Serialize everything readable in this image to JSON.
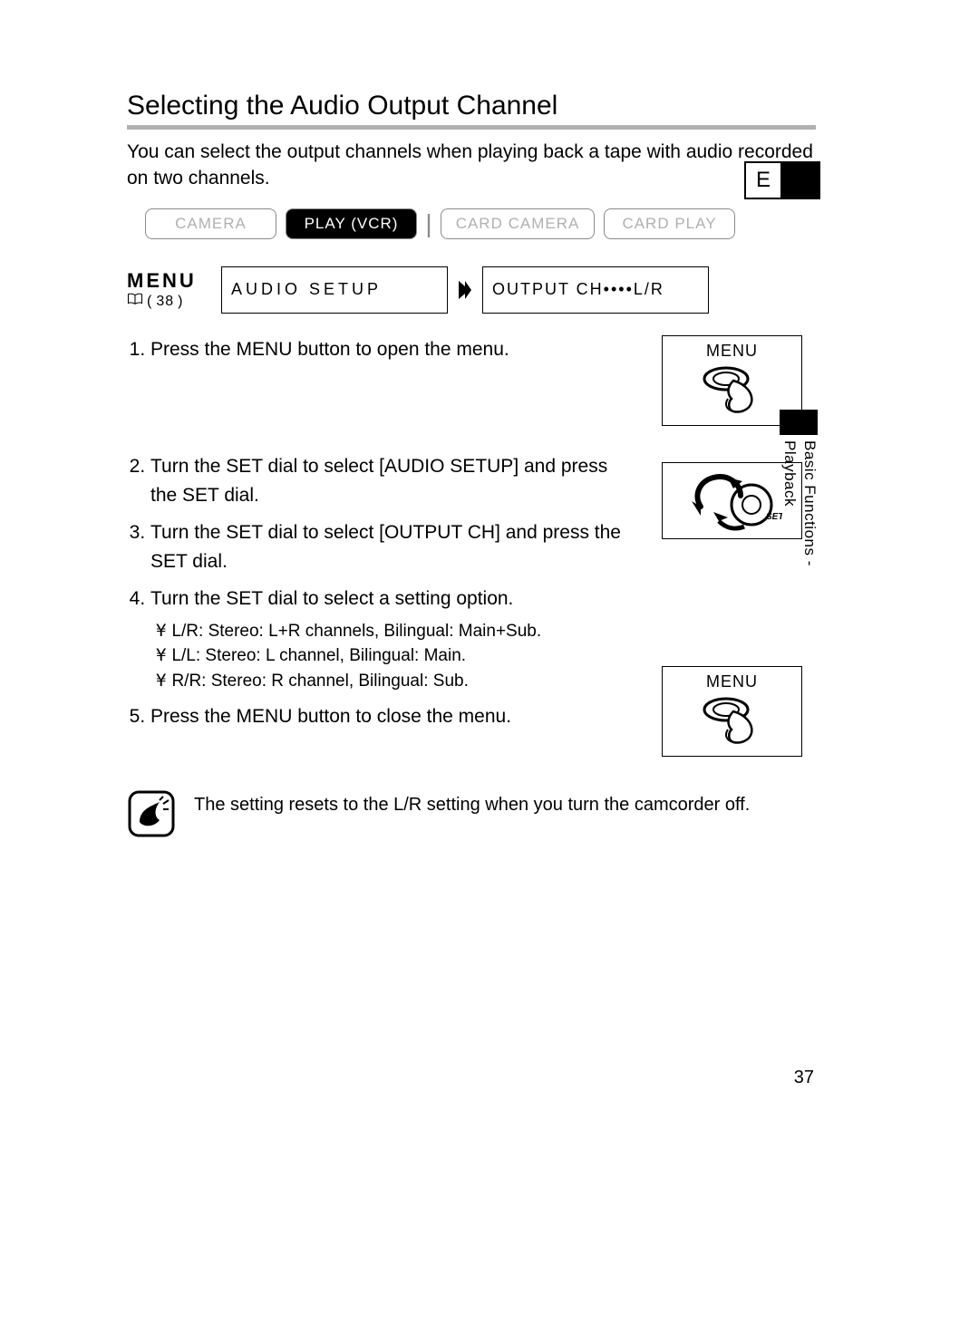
{
  "title": "Selecting the Audio Output Channel",
  "intro": "You can select the output channels when playing back a tape with audio recorded on two channels.",
  "modes": {
    "camera": "CAMERA",
    "play_vcr": "PLAY (VCR)",
    "card_camera": "CARD CAMERA",
    "card_play": "CARD PLAY"
  },
  "menu": {
    "label": "MENU",
    "ref_page": "38",
    "cell1": "AUDIO SETUP",
    "cell2": "OUTPUT CH••••L/R"
  },
  "steps": {
    "s1": "Press the MENU button to open the menu.",
    "s2": "Turn the SET dial to select [AUDIO SETUP] and press the SET dial.",
    "s3": "Turn the SET dial to select [OUTPUT CH] and press the SET dial.",
    "s4": "Turn the SET dial to select a setting option.",
    "s4a": "L/R: Stereo: L+R channels, Bilingual: Main+Sub.",
    "s4b": "L/L: Stereo: L channel, Bilingual: Main.",
    "s4c": "R/R: Stereo: R channel, Bilingual: Sub.",
    "s5": "Press the MENU button to close the menu."
  },
  "panel_labels": {
    "menu": "MENU"
  },
  "note": "The setting resets to the L/R setting when you turn the camcorder off.",
  "lang_badge": "E",
  "side_label_line1": "Basic Functions -",
  "side_label_line2": "Playback",
  "page_number": "37"
}
